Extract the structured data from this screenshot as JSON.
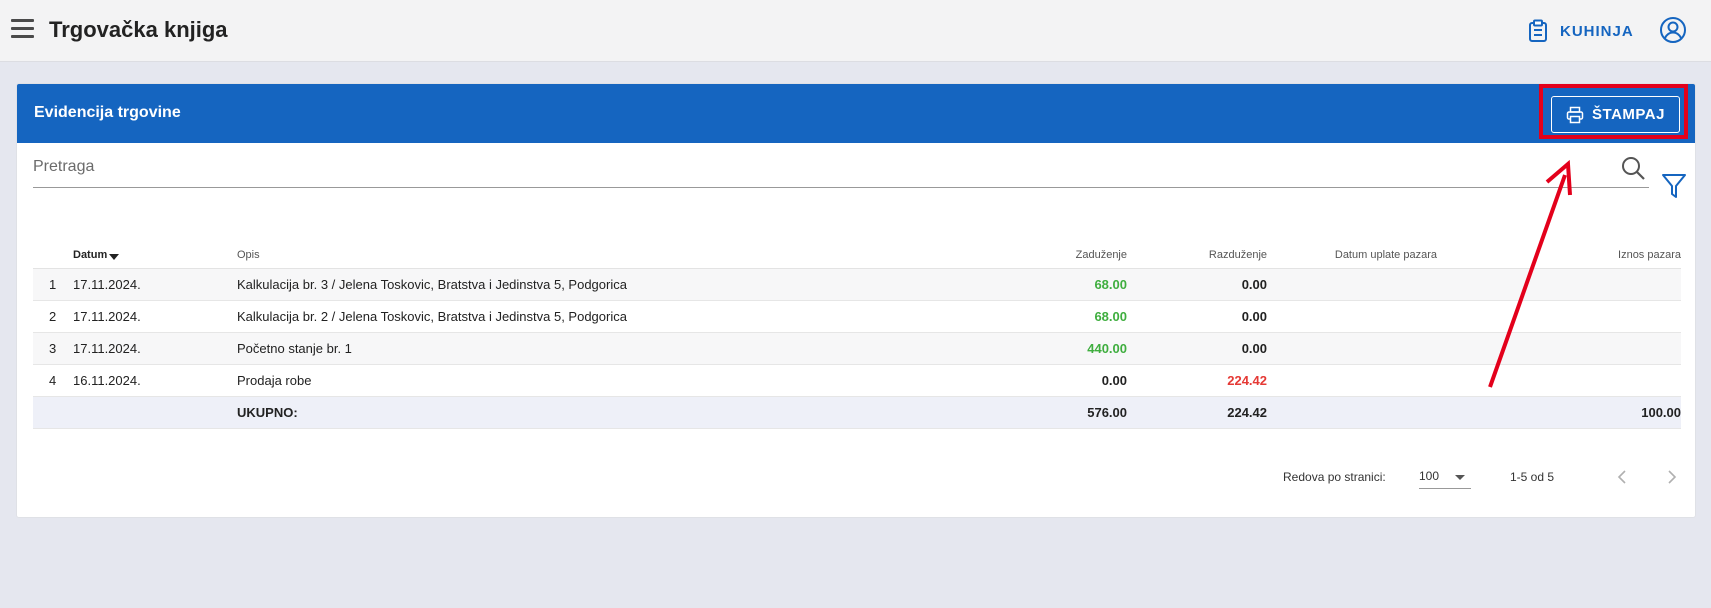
{
  "app": {
    "title": "Trgovačka knjiga"
  },
  "topbar": {
    "kuhinja_label": "KUHINJA"
  },
  "card": {
    "title": "Evidencija trgovine",
    "print_label": "ŠTAMPAJ"
  },
  "search": {
    "placeholder": "Pretraga",
    "value": ""
  },
  "table": {
    "headers": {
      "datum": "Datum",
      "opis": "Opis",
      "zaduzenje": "Zaduženje",
      "razduzenje": "Razduženje",
      "datum_uplate": "Datum uplate pazara",
      "iznos_pazara": "Iznos pazara"
    },
    "rows": [
      {
        "no": "1",
        "datum": "17.11.2024.",
        "opis": "Kalkulacija br. 3 / Jelena Toskovic, Bratstva i Jedinstva 5, Podgorica",
        "zaduzenje": "68.00",
        "razduzenje": "0.00",
        "datum_uplate": "",
        "iznos": ""
      },
      {
        "no": "2",
        "datum": "17.11.2024.",
        "opis": "Kalkulacija br. 2 / Jelena Toskovic, Bratstva i Jedinstva 5, Podgorica",
        "zaduzenje": "68.00",
        "razduzenje": "0.00",
        "datum_uplate": "",
        "iznos": ""
      },
      {
        "no": "3",
        "datum": "17.11.2024.",
        "opis": "Početno stanje br. 1",
        "zaduzenje": "440.00",
        "razduzenje": "0.00",
        "datum_uplate": "",
        "iznos": ""
      },
      {
        "no": "4",
        "datum": "16.11.2024.",
        "opis": "Prodaja robe",
        "zaduzenje": "0.00",
        "razduzenje": "224.42",
        "datum_uplate": "",
        "iznos": ""
      }
    ],
    "total": {
      "label": "UKUPNO:",
      "zaduzenje": "576.00",
      "razduzenje": "224.42",
      "iznos": "100.00"
    }
  },
  "pagination": {
    "rows_per_page_label": "Redova po stranici:",
    "rows_per_page": "100",
    "range": "1-5 od 5"
  },
  "colors": {
    "accent": "#1565c0",
    "positive": "#3fae3f",
    "negative": "#e53935",
    "annotation": "#e3001b"
  }
}
